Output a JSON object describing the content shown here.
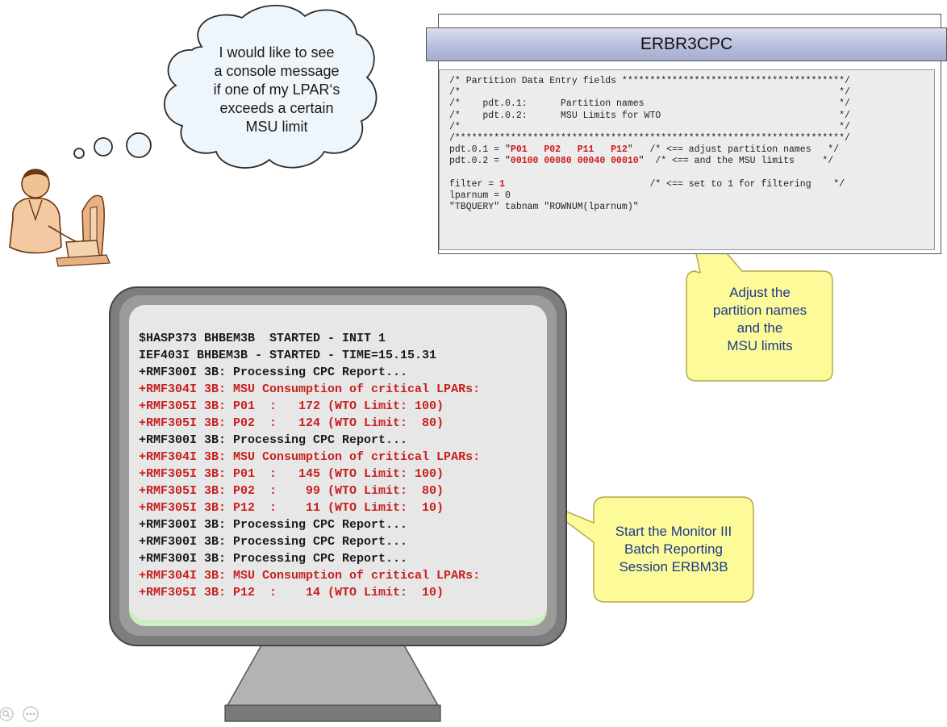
{
  "thought_bubble": {
    "lines": [
      "I would like to see",
      "a console message",
      "if one of my LPAR‘s",
      "exceeds a certain",
      "MSU limit"
    ]
  },
  "code_panel": {
    "title": "ERBR3CPC",
    "lines": [
      [
        {
          "t": "/* Partition Data Entry fields ****************************************/"
        }
      ],
      [
        {
          "t": "/*                                                                    */"
        }
      ],
      [
        {
          "t": "/*    pdt.0.1:      Partition names                                   */"
        }
      ],
      [
        {
          "t": "/*    pdt.0.2:      MSU Limits for WTO                                */"
        }
      ],
      [
        {
          "t": "/*                                                                    */"
        }
      ],
      [
        {
          "t": "/**********************************************************************/"
        }
      ],
      [
        {
          "t": "pdt.0.1 = \""
        },
        {
          "t": "P01   P02   P11   P12",
          "red": true
        },
        {
          "t": "\"   /* <== adjust partition names   */"
        }
      ],
      [
        {
          "t": "pdt.0.2 = \""
        },
        {
          "t": "00100 00080 00040 00010",
          "red": true
        },
        {
          "t": "\"  /* <== and the MSU limits     */"
        }
      ],
      [
        {
          "t": " "
        }
      ],
      [
        {
          "t": "filter = "
        },
        {
          "t": "1",
          "red": true
        },
        {
          "t": "                          /* <== set to 1 for filtering    */"
        }
      ],
      [
        {
          "t": "lparnum = 0"
        }
      ],
      [
        {
          "t": "\"TBQUERY\" tabnam \"ROWNUM(lparnum)\""
        }
      ]
    ]
  },
  "callout_top": {
    "lines": [
      "Adjust the",
      "partition names",
      "and the",
      "MSU limits"
    ]
  },
  "callout_bottom": {
    "lines": [
      "Start the Monitor III",
      "Batch Reporting",
      "Session ERBM3B"
    ]
  },
  "console": {
    "lines": [
      {
        "text": "$HASP373 BHBEM3B  STARTED - INIT 1",
        "red": false
      },
      {
        "text": "IEF403I BHBEM3B - STARTED - TIME=15.15.31",
        "red": false
      },
      {
        "text": "+RMF300I 3B: Processing CPC Report...",
        "red": false
      },
      {
        "text": "+RMF304I 3B: MSU Consumption of critical LPARs:",
        "red": true
      },
      {
        "text": "+RMF305I 3B: P01  :   172 (WTO Limit: 100)",
        "red": true
      },
      {
        "text": "+RMF305I 3B: P02  :   124 (WTO Limit:  80)",
        "red": true
      },
      {
        "text": "+RMF300I 3B: Processing CPC Report...",
        "red": false
      },
      {
        "text": "+RMF304I 3B: MSU Consumption of critical LPARs:",
        "red": true
      },
      {
        "text": "+RMF305I 3B: P01  :   145 (WTO Limit: 100)",
        "red": true
      },
      {
        "text": "+RMF305I 3B: P02  :    99 (WTO Limit:  80)",
        "red": true
      },
      {
        "text": "+RMF305I 3B: P12  :    11 (WTO Limit:  10)",
        "red": true
      },
      {
        "text": "+RMF300I 3B: Processing CPC Report...",
        "red": false
      },
      {
        "text": "+RMF300I 3B: Processing CPC Report...",
        "red": false
      },
      {
        "text": "+RMF300I 3B: Processing CPC Report...",
        "red": false
      },
      {
        "text": "+RMF304I 3B: MSU Consumption of critical LPARs:",
        "red": true
      },
      {
        "text": "+RMF305I 3B: P12  :    14 (WTO Limit:  10)",
        "red": true
      }
    ]
  },
  "colors": {
    "highlight_red": "#c8201e",
    "callout_fill": "#fdfa9a",
    "callout_text": "#1b3a8c",
    "title_bar": "#b9bedb"
  },
  "icons": [
    "user-at-computer-icon",
    "zoom-icon",
    "more-options-icon"
  ]
}
